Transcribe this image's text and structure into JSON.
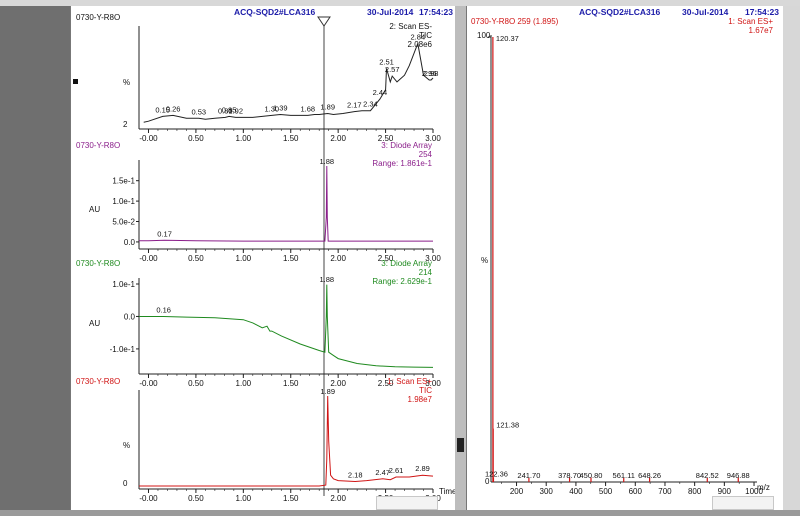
{
  "colors": {
    "black": "#222222",
    "purple": "#8b1f8b",
    "green": "#1f8a1f",
    "red": "#d01414",
    "blue": "#1a1aa8"
  },
  "left_header": {
    "instrument": "ACQ-SQD2#LCA316",
    "date": "30-Jul-2014",
    "time": "17:54:23"
  },
  "right_header": {
    "instrument": "ACQ-SQD2#LCA316",
    "date": "30-Jul-2014",
    "time": "17:54:23"
  },
  "xaxis": {
    "ticks": [
      "-0.00",
      "0.50",
      "1.00",
      "1.50",
      "2.00",
      "2.50",
      "3.00"
    ],
    "time_label": "Time"
  },
  "chart_data": [
    {
      "type": "line",
      "sample": "0730-Y-R8O",
      "trace_info": [
        "2: Scan ES-",
        "TIC",
        "2.08e6"
      ],
      "ylabel": "%",
      "yticks": [
        "2"
      ],
      "xlim": [
        -0.1,
        3.0
      ],
      "ylim": [
        2,
        100
      ],
      "series": [
        {
          "x": [
            -0.05,
            0.0,
            0.15,
            0.26,
            0.4,
            0.53,
            0.6,
            0.7,
            0.81,
            0.85,
            0.92,
            1.0,
            1.1,
            1.2,
            1.3,
            1.39,
            1.5,
            1.68,
            1.75,
            1.8,
            1.89,
            1.95,
            2.05,
            2.17,
            2.25,
            2.34,
            2.44,
            2.5,
            2.51,
            2.55,
            2.57,
            2.62,
            2.7,
            2.75,
            2.84,
            2.9,
            2.96,
            2.98,
            3.0
          ],
          "y": [
            6,
            7,
            12,
            13,
            10,
            10,
            9,
            10,
            11,
            12,
            11,
            11,
            11,
            12,
            13,
            14,
            13,
            13,
            14,
            14,
            15,
            14,
            15,
            17,
            18,
            18,
            30,
            40,
            62,
            48,
            54,
            48,
            55,
            65,
            88,
            55,
            50,
            50,
            52
          ]
        }
      ],
      "annotations": [
        {
          "x": 0.15,
          "label": "0.15"
        },
        {
          "x": 0.26,
          "label": "0.26"
        },
        {
          "x": 0.53,
          "label": "0.53"
        },
        {
          "x": 0.81,
          "label": "0.81"
        },
        {
          "x": 0.85,
          "label": "0.85"
        },
        {
          "x": 0.92,
          "label": "0.92"
        },
        {
          "x": 1.3,
          "label": "1.30"
        },
        {
          "x": 1.39,
          "label": "1.39"
        },
        {
          "x": 1.68,
          "label": "1.68"
        },
        {
          "x": 1.89,
          "label": "1.89"
        },
        {
          "x": 2.17,
          "label": "2.17"
        },
        {
          "x": 2.34,
          "label": "2.34"
        },
        {
          "x": 2.44,
          "label": "2.44"
        },
        {
          "x": 2.51,
          "label": "2.51"
        },
        {
          "x": 2.57,
          "label": "2.57"
        },
        {
          "x": 2.84,
          "label": "2.84"
        },
        {
          "x": 2.96,
          "label": "2.96"
        },
        {
          "x": 2.98,
          "label": "2.98"
        }
      ]
    },
    {
      "type": "line",
      "sample": "0730-Y-R8O",
      "trace_info": [
        "3: Diode Array",
        "254",
        "Range: 1.861e-1"
      ],
      "ylabel": "AU",
      "yticks": [
        "1.5e-1",
        "1.0e-1",
        "5.0e-2",
        "0.0"
      ],
      "ytick_values": [
        0.15,
        0.1,
        0.05,
        0.0
      ],
      "xlim": [
        -0.1,
        3.0
      ],
      "ylim": [
        -0.01,
        0.186
      ],
      "series": [
        {
          "x": [
            -0.1,
            0.0,
            0.17,
            0.5,
            1.0,
            1.5,
            1.8,
            1.86,
            1.875,
            1.88,
            1.885,
            1.895,
            1.91,
            2.0,
            2.5,
            3.0
          ],
          "y": [
            0.003,
            0.003,
            0.004,
            0.003,
            0.002,
            0.002,
            0.002,
            0.002,
            0.06,
            0.186,
            0.06,
            0.002,
            0.002,
            0.002,
            0.002,
            0.002
          ]
        }
      ],
      "annotations": [
        {
          "x": 0.17,
          "label": "0.17"
        },
        {
          "x": 1.88,
          "label": "1.88"
        }
      ]
    },
    {
      "type": "line",
      "sample": "0730-Y-R8O",
      "trace_info": [
        "3: Diode Array",
        "214",
        "Range: 2.629e-1"
      ],
      "ylabel": "AU",
      "yticks": [
        "1.0e-1",
        "0.0",
        "-1.0e-1"
      ],
      "ytick_values": [
        0.1,
        0.0,
        -0.1
      ],
      "xlim": [
        -0.1,
        3.0
      ],
      "ylim": [
        -0.165,
        0.1
      ],
      "series": [
        {
          "x": [
            -0.1,
            0.0,
            0.16,
            0.4,
            0.7,
            1.0,
            1.1,
            1.2,
            1.25,
            1.28,
            1.3,
            1.4,
            1.6,
            1.8,
            1.86,
            1.875,
            1.88,
            1.885,
            1.9,
            1.95,
            2.0,
            2.2,
            2.4,
            2.6,
            2.8,
            3.0
          ],
          "y": [
            0.0,
            0.0,
            0.0,
            -0.002,
            -0.004,
            -0.01,
            -0.02,
            -0.035,
            -0.03,
            -0.045,
            -0.045,
            -0.06,
            -0.085,
            -0.105,
            -0.11,
            0.0,
            0.098,
            0.0,
            -0.11,
            -0.12,
            -0.13,
            -0.145,
            -0.152,
            -0.155,
            -0.156,
            -0.157
          ]
        }
      ],
      "annotations": [
        {
          "x": 0.16,
          "label": "0.16"
        },
        {
          "x": 1.88,
          "label": "1.88"
        }
      ]
    },
    {
      "type": "line",
      "sample": "0730-Y-R8O",
      "trace_info": [
        "1: Scan ES+",
        "TIC",
        "1.98e7"
      ],
      "ylabel": "%",
      "yticks": [
        "0"
      ],
      "xlim": [
        -0.1,
        3.0
      ],
      "ylim": [
        0,
        100
      ],
      "series": [
        {
          "x": [
            -0.1,
            0.0,
            0.5,
            1.0,
            1.5,
            1.8,
            1.87,
            1.88,
            1.89,
            1.9,
            1.92,
            1.95,
            2.0,
            2.18,
            2.3,
            2.47,
            2.55,
            2.61,
            2.75,
            2.89,
            3.0
          ],
          "y": [
            0,
            0,
            0,
            0,
            0,
            0,
            1,
            30,
            100,
            50,
            12,
            8,
            6,
            5,
            6,
            8,
            7,
            10,
            10,
            12,
            11
          ]
        }
      ],
      "annotations": [
        {
          "x": 1.89,
          "label": "1.89"
        },
        {
          "x": 2.18,
          "label": "2.18"
        },
        {
          "x": 2.47,
          "label": "2.47"
        },
        {
          "x": 2.61,
          "label": "2.61"
        },
        {
          "x": 2.89,
          "label": "2.89"
        }
      ]
    },
    {
      "type": "bar",
      "sample": "0730-Y-R8O 259 (1.895)",
      "trace_info": [
        "1: Scan ES+",
        "1.67e7"
      ],
      "ylabel": "%",
      "yticks": [
        "100",
        "0"
      ],
      "xlabel": "m/z",
      "xticks": [
        "200",
        "300",
        "400",
        "500",
        "600",
        "700",
        "800",
        "900",
        "1000"
      ],
      "xlim": [
        150,
        1000
      ],
      "ylim": [
        0,
        100
      ],
      "series": [
        {
          "x": [
            120.37,
            121.38,
            122.36,
            241.7,
            378.7,
            450.8,
            561.11,
            648.26,
            842.52,
            946.88
          ],
          "y": [
            100,
            12,
            1,
            1,
            1,
            1,
            1,
            1,
            1,
            1
          ]
        }
      ],
      "annotations": [
        {
          "x": 120.37,
          "label": "120.37"
        },
        {
          "x": 121.38,
          "label": "121.38"
        },
        {
          "x": 122.36,
          "label": "122.36"
        },
        {
          "x": 241.7,
          "label": "241.70"
        },
        {
          "x": 378.7,
          "label": "378.70"
        },
        {
          "x": 450.8,
          "label": "450.80"
        },
        {
          "x": 561.11,
          "label": "561.11"
        },
        {
          "x": 648.26,
          "label": "648.26"
        },
        {
          "x": 842.52,
          "label": "842.52"
        },
        {
          "x": 946.88,
          "label": "946.88"
        }
      ]
    }
  ]
}
